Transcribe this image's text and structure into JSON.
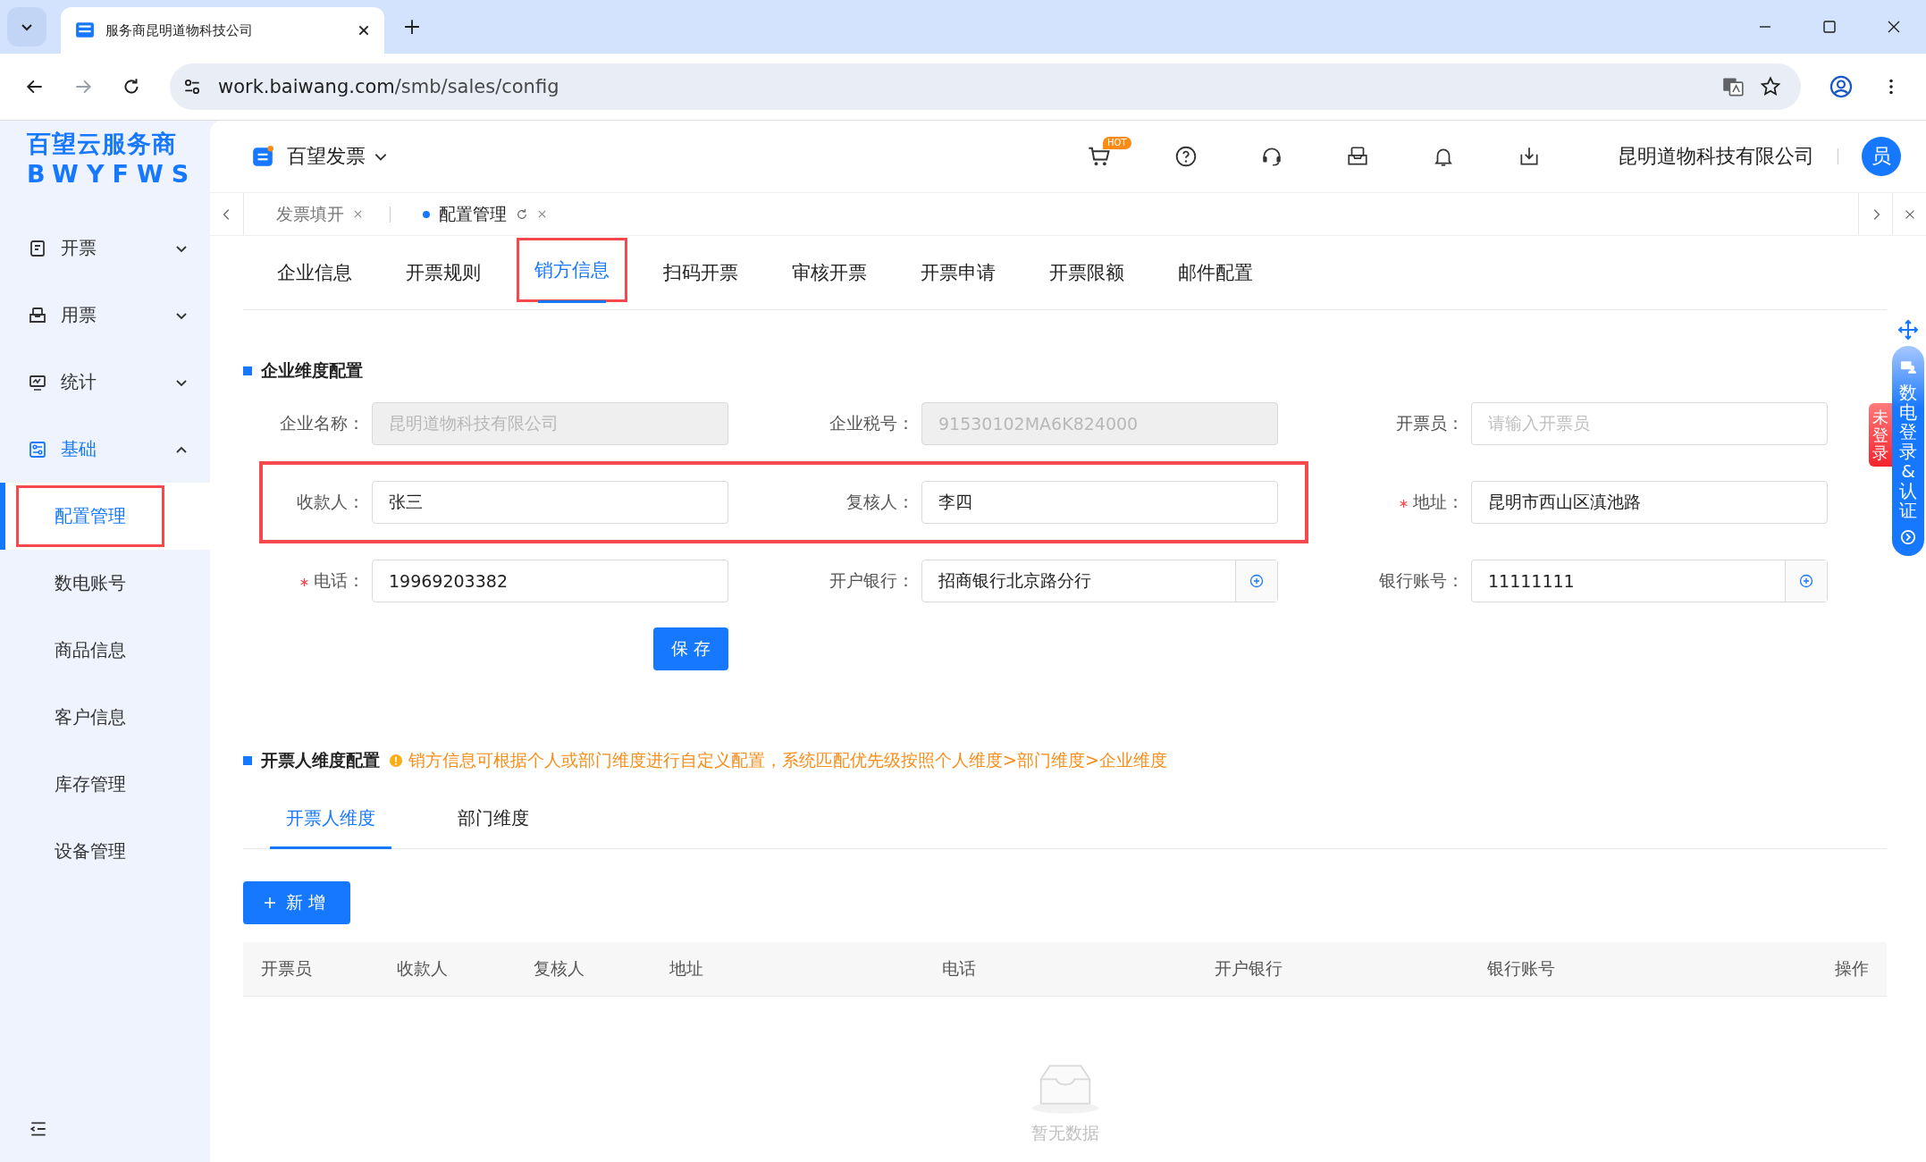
{
  "browser": {
    "tab_title": "服务商昆明道物科技公司",
    "url_host": "work.baiwang.com",
    "url_path": "/smb/sales/config"
  },
  "sidebar": {
    "logo_line1": "百望云服务商",
    "logo_line2": "BWYFWS",
    "items": [
      {
        "label": "开票",
        "expanded": false
      },
      {
        "label": "用票",
        "expanded": false
      },
      {
        "label": "统计",
        "expanded": false
      },
      {
        "label": "基础",
        "expanded": true,
        "children": [
          {
            "label": "配置管理",
            "selected": true,
            "highlighted": true
          },
          {
            "label": "数电账号",
            "selected": false,
            "highlighted": false
          },
          {
            "label": "商品信息",
            "selected": false,
            "highlighted": false
          },
          {
            "label": "客户信息",
            "selected": false,
            "highlighted": false
          },
          {
            "label": "库存管理",
            "selected": false,
            "highlighted": false
          },
          {
            "label": "设备管理",
            "selected": false,
            "highlighted": false
          }
        ]
      }
    ]
  },
  "header": {
    "app_name": "百望发票",
    "hot_badge": "HOT",
    "company": "昆明道物科技有限公司",
    "avatar": "员"
  },
  "page_tabs": [
    {
      "label": "发票填开",
      "selected": false
    },
    {
      "label": "配置管理",
      "selected": true
    }
  ],
  "subtabs": [
    {
      "label": "企业信息",
      "selected": false,
      "highlighted": false
    },
    {
      "label": "开票规则",
      "selected": false,
      "highlighted": false
    },
    {
      "label": "销方信息",
      "selected": true,
      "highlighted": true
    },
    {
      "label": "扫码开票",
      "selected": false,
      "highlighted": false
    },
    {
      "label": "审核开票",
      "selected": false,
      "highlighted": false
    },
    {
      "label": "开票申请",
      "selected": false,
      "highlighted": false
    },
    {
      "label": "开票限额",
      "selected": false,
      "highlighted": false
    },
    {
      "label": "邮件配置",
      "selected": false,
      "highlighted": false
    }
  ],
  "enterprise_section": {
    "title": "企业维度配置",
    "rows": [
      [
        {
          "fields": [
            {
              "label": "企业名称：",
              "kind": "disabled",
              "required": false,
              "value": "昆明道物科技有限公司"
            },
            {
              "label": "企业税号：",
              "kind": "disabled",
              "required": false,
              "value": "91530102MA6K824000"
            },
            {
              "label": "开票员：",
              "kind": "input",
              "required": false,
              "placeholder": "请输入开票员"
            }
          ]
        }
      ],
      [
        {
          "highlighted": true,
          "fields": [
            {
              "label": "收款人：",
              "kind": "input",
              "required": false,
              "value": "张三"
            },
            {
              "label": "复核人：",
              "kind": "input",
              "required": false,
              "value": "李四"
            }
          ]
        },
        {
          "fields": [
            {
              "label": "地址：",
              "kind": "input",
              "required": true,
              "value": "昆明市西山区滇池路"
            }
          ]
        }
      ],
      [
        {
          "fields": [
            {
              "label": "电话：",
              "kind": "input",
              "required": true,
              "value": "19969203382"
            },
            {
              "label": "开户银行：",
              "kind": "addon",
              "required": false,
              "value": "招商银行北京路分行"
            },
            {
              "label": "银行账号：",
              "kind": "addon",
              "required": false,
              "value": "11111111"
            }
          ]
        }
      ]
    ],
    "save_button": "保存"
  },
  "drawer_section": {
    "title": "开票人维度配置",
    "notice": "销方信息可根据个人或部门维度进行自定义配置，系统匹配优先级按照个人维度>部门维度>企业维度",
    "tabs": [
      {
        "label": "开票人维度",
        "selected": true
      },
      {
        "label": "部门维度",
        "selected": false
      }
    ],
    "add_button": "新增",
    "table": {
      "columns": [
        "开票员",
        "收款人",
        "复核人",
        "地址",
        "电话",
        "开户银行",
        "银行账号",
        "操作"
      ],
      "empty_text": "暂无数据"
    }
  },
  "float_widget": {
    "login_label": "数电登录&认证",
    "status_tag": "未登录"
  }
}
